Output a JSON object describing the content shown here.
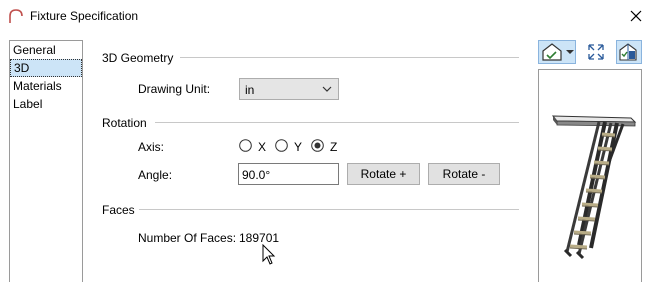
{
  "window": {
    "title": "Fixture Specification",
    "icon": "arch-icon",
    "close_icon": "close-icon"
  },
  "sidebar": {
    "items": [
      {
        "label": "General",
        "selected": false
      },
      {
        "label": "3D",
        "selected": true
      },
      {
        "label": "Materials",
        "selected": false
      },
      {
        "label": "Label",
        "selected": false
      }
    ]
  },
  "geometry": {
    "section_title": "3D Geometry",
    "drawing_unit_label": "Drawing Unit:",
    "drawing_unit_value": "in"
  },
  "rotation": {
    "section_title": "Rotation",
    "axis_label": "Axis:",
    "axis_options": [
      "X",
      "Y",
      "Z"
    ],
    "axis_selected": "Z",
    "angle_label": "Angle:",
    "angle_value": "90.0°",
    "rotate_plus_label": "Rotate +",
    "rotate_minus_label": "Rotate -"
  },
  "faces": {
    "section_title": "Faces",
    "count_label": "Number Of Faces:",
    "count_value": "189701"
  },
  "preview_toolbar": {
    "icons": [
      "camera-view-icon",
      "dropdown-arrow-icon",
      "fill-window-icon",
      "toggle-view-icon"
    ]
  },
  "colors": {
    "selection": "#cce4f7",
    "accent_border": "#8ab4de",
    "app_icon": "#c0504d"
  }
}
